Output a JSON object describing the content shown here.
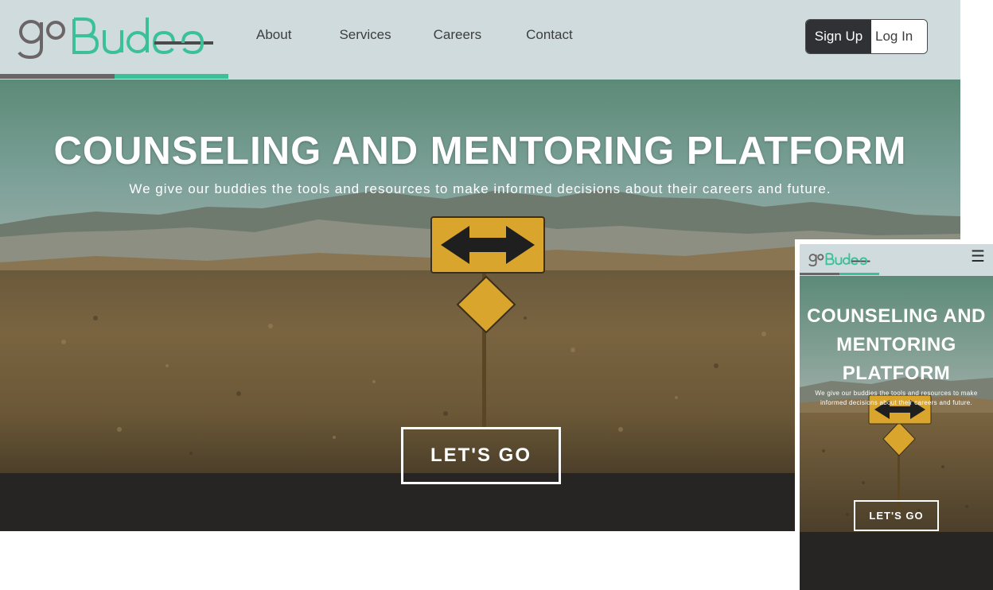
{
  "brand": {
    "logo_text": "goBudee",
    "colors": {
      "gray": "#6c6567",
      "teal": "#3cc09a"
    }
  },
  "nav": {
    "links": [
      "About",
      "Services",
      "Careers",
      "Contact"
    ],
    "signup_label": "Sign Up",
    "login_label": "Log In"
  },
  "hero": {
    "title": "COUNSELING AND MENTORING PLATFORM",
    "subtitle": "We give our buddies the tools and resources to make informed decisions about their careers and future.",
    "cta_label": "LET'S  GO"
  },
  "mobile": {
    "menu_icon": "hamburger-icon",
    "title": "COUNSELING AND MENTORING PLATFORM",
    "subtitle": "We give our buddies the tools and resources to make informed decisions about their careers and future.",
    "cta_label": "LET'S  GO"
  }
}
